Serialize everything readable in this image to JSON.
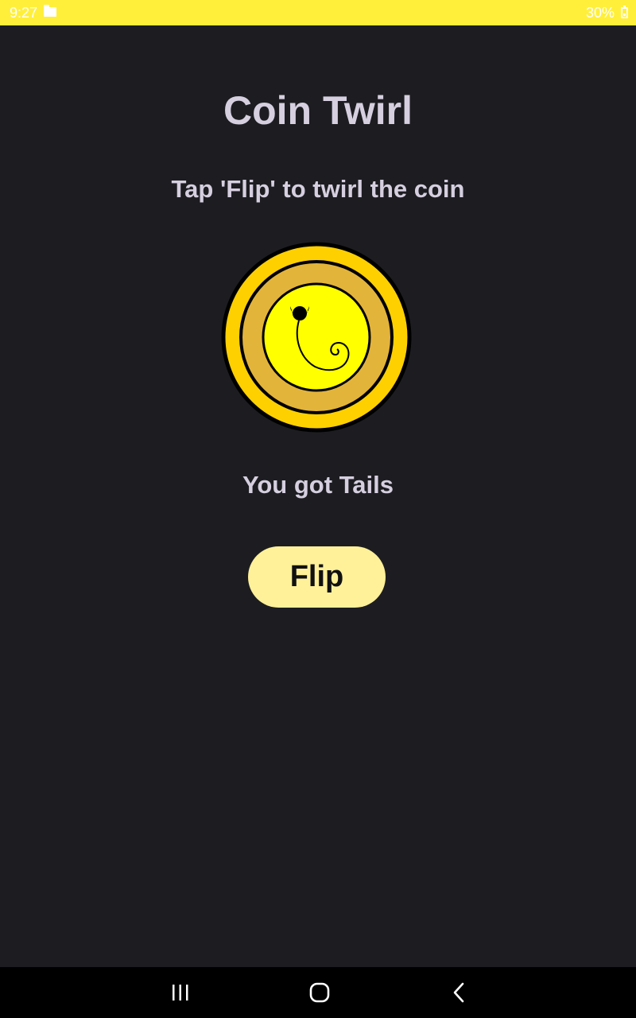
{
  "status_bar": {
    "time": "9:27",
    "battery_percent": "30%",
    "battery_level": 0.3,
    "background_color": "#ffef3a"
  },
  "app": {
    "title": "Coin Twirl",
    "instruction": "Tap 'Flip' to twirl the coin",
    "result_text": "You got Tails",
    "flip_button_label": "Flip",
    "coin_face": "tails",
    "colors": {
      "background": "#1d1d21",
      "text": "#d5cfe0",
      "button": "#fff19a",
      "coin_outer": "#ffd000",
      "coin_ring": "#e3b43a",
      "coin_center": "#ffff00"
    }
  },
  "nav_bar": {
    "buttons": [
      "recents-icon",
      "home-icon",
      "back-icon"
    ]
  }
}
